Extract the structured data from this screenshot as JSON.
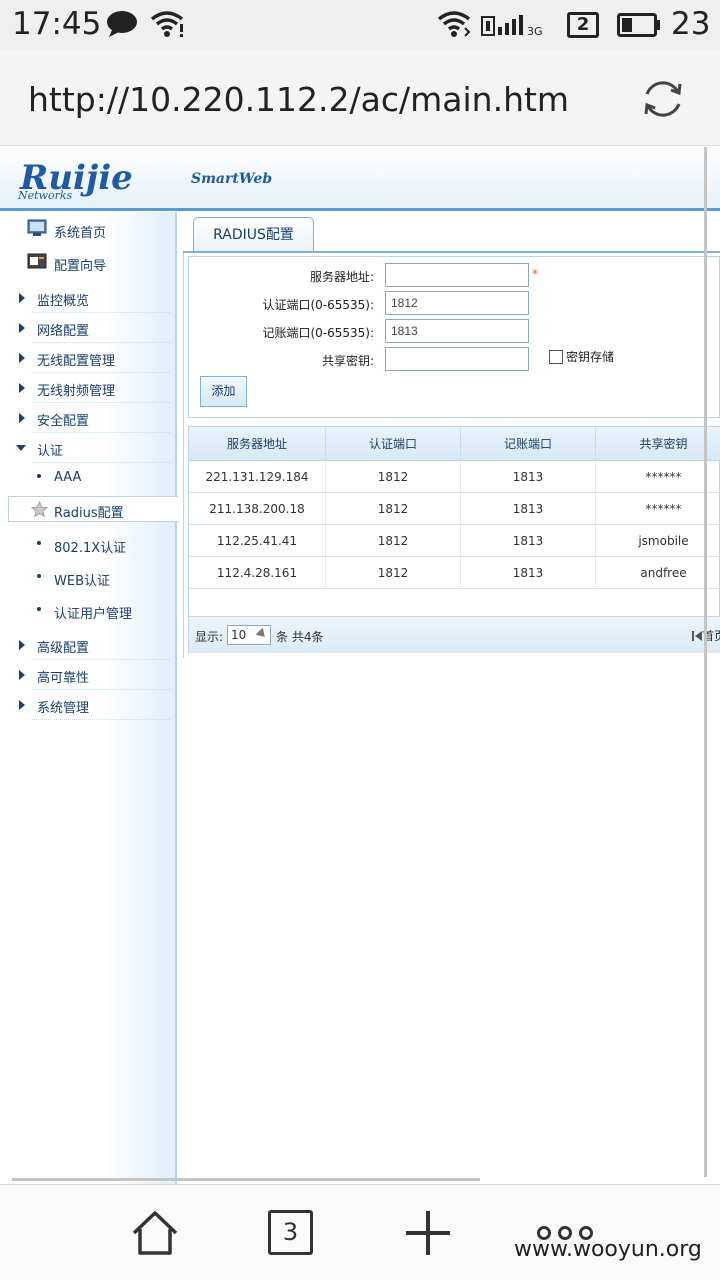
{
  "status_bar": {
    "time": "17:45",
    "sim_slot": "2",
    "network_type": "3G",
    "battery_percent": "23",
    "icons": [
      "chat-icon",
      "wifi-icon",
      "wifi-icon",
      "signal-icon",
      "sim-icon",
      "battery-icon"
    ]
  },
  "browser": {
    "url": "http://10.220.112.2/ac/main.htm",
    "reload_icon": "reload-icon",
    "open_tabs": "3",
    "toolbar_icons": [
      "home-icon",
      "tabs-icon",
      "plus-icon",
      "more-icon"
    ]
  },
  "header": {
    "brand": "Ruijie",
    "brand_sub": "Networks",
    "product": "SmartWeb"
  },
  "sidebar": {
    "items": [
      {
        "label": "系统首页",
        "icon": "home-page-icon"
      },
      {
        "label": "配置向导",
        "icon": "wizard-icon"
      },
      {
        "label": "监控概览"
      },
      {
        "label": "网络配置"
      },
      {
        "label": "无线配置管理"
      },
      {
        "label": "无线射频管理"
      },
      {
        "label": "安全配置"
      },
      {
        "label": "认证"
      },
      {
        "label": "AAA"
      },
      {
        "label": "Radius配置",
        "icon": "star-icon"
      },
      {
        "label": "802.1X认证"
      },
      {
        "label": "WEB认证"
      },
      {
        "label": "认证用户管理"
      },
      {
        "label": "高级配置"
      },
      {
        "label": "高可靠性"
      },
      {
        "label": "系统管理"
      }
    ]
  },
  "main": {
    "tab_label": "RADIUS配置",
    "form": {
      "server_label": "服务器地址:",
      "server_value": "",
      "auth_port_label": "认证端口(0-65535):",
      "auth_port_value": "1812",
      "acct_port_label": "记账端口(0-65535):",
      "acct_port_value": "1813",
      "secret_label": "共享密钥:",
      "secret_value": "",
      "required_mark": "*",
      "store_key_label": "密钥存储",
      "add_button": "添加"
    },
    "table": {
      "columns": [
        "服务器地址",
        "认证端口",
        "记账端口",
        "共享密钥"
      ],
      "rows": [
        [
          "221.131.129.184",
          "1812",
          "1813",
          "******"
        ],
        [
          "211.138.200.18",
          "1812",
          "1813",
          "******"
        ],
        [
          "112.25.41.41",
          "1812",
          "1813",
          "jsmobile"
        ],
        [
          "112.4.28.161",
          "1812",
          "1813",
          "andfree"
        ]
      ],
      "pager": {
        "show_label": "显示:",
        "page_size": "10",
        "count_text": "条 共4条",
        "first_label": "首页"
      }
    }
  },
  "watermark": "www.wooyun.org",
  "colors": {
    "brand_blue": "#1d5aa8",
    "accent_border": "#7fb0da",
    "required_orange": "#e05a1a"
  }
}
